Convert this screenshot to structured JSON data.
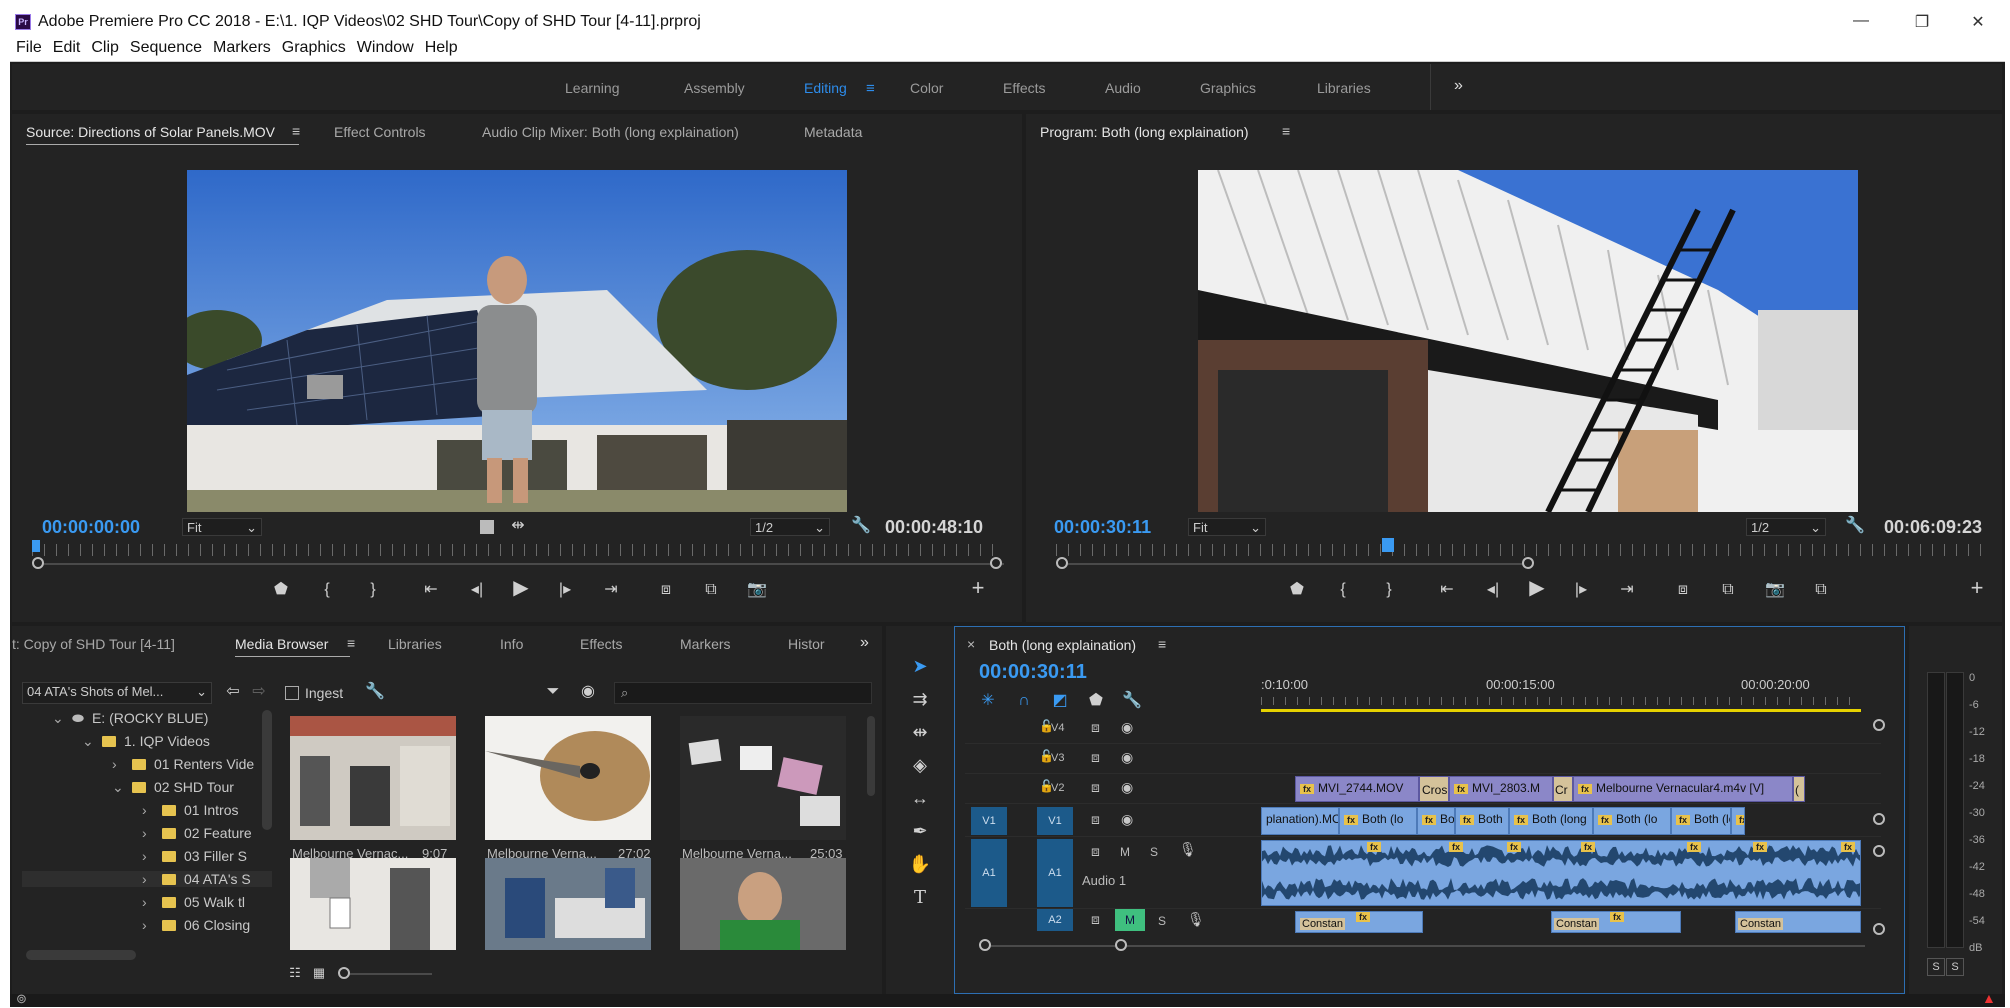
{
  "window": {
    "title": "Adobe Premiere Pro CC 2018 - E:\\1. IQP Videos\\02 SHD Tour\\Copy of SHD Tour [4-11].prproj",
    "app_icon_text": "Pr",
    "controls": {
      "minimize": "—",
      "maximize": "❐",
      "close": "✕"
    }
  },
  "menu": [
    "File",
    "Edit",
    "Clip",
    "Sequence",
    "Markers",
    "Graphics",
    "Window",
    "Help"
  ],
  "workspaces": {
    "items": [
      "Learning",
      "Assembly",
      "Editing",
      "Color",
      "Effects",
      "Audio",
      "Graphics",
      "Libraries"
    ],
    "active": "Editing",
    "overflow": "»"
  },
  "source_monitor": {
    "tabs": [
      "Source: Directions of Solar Panels.MOV",
      "Effect Controls",
      "Audio Clip Mixer: Both (long explaination)",
      "Metadata"
    ],
    "timecode_in": "00:00:00:00",
    "timecode_duration": "00:00:48:10",
    "fit": "Fit",
    "resolution": "1/2",
    "playhead_fraction": 0.0,
    "add_button": "+"
  },
  "program_monitor": {
    "tabs": [
      "Program: Both (long explaination)"
    ],
    "timecode_in": "00:00:30:11",
    "timecode_duration": "00:06:09:23",
    "fit": "Fit",
    "resolution": "1/2",
    "playhead_fraction": 0.35,
    "add_button": "+"
  },
  "project_panel": {
    "tabs": [
      "t: Copy of SHD Tour [4-11]",
      "Media Browser",
      "Libraries",
      "Info",
      "Effects",
      "Markers",
      "Histor"
    ],
    "overflow": "»",
    "location": "04 ATA's Shots of Mel...",
    "ingest_label": "Ingest",
    "search_placeholder": "",
    "tree": [
      {
        "label": "E: (ROCKY BLUE)",
        "indent": 0,
        "kind": "drive",
        "chev": "⌄"
      },
      {
        "label": "1. IQP Videos",
        "indent": 1,
        "kind": "folder",
        "chev": "⌄"
      },
      {
        "label": "01 Renters Vide",
        "indent": 2,
        "kind": "folder",
        "chev": "›"
      },
      {
        "label": "02 SHD Tour",
        "indent": 2,
        "kind": "folder",
        "chev": "⌄"
      },
      {
        "label": "01 Intros",
        "indent": 3,
        "kind": "folder",
        "chev": "›"
      },
      {
        "label": "02 Feature",
        "indent": 3,
        "kind": "folder",
        "chev": "›"
      },
      {
        "label": "03 Filler S",
        "indent": 3,
        "kind": "folder",
        "chev": "›"
      },
      {
        "label": "04 ATA's S",
        "indent": 3,
        "kind": "folder",
        "chev": "›"
      },
      {
        "label": "05 Walk tl",
        "indent": 3,
        "kind": "folder",
        "chev": "›"
      },
      {
        "label": "06 Closing",
        "indent": 3,
        "kind": "folder",
        "chev": "›"
      }
    ],
    "clips": [
      {
        "name": "Melbourne Vernac...",
        "duration": "9:07"
      },
      {
        "name": "Melbourne Verna...",
        "duration": "27:02"
      },
      {
        "name": "Melbourne Verna...",
        "duration": "25:03"
      },
      {
        "name": "",
        "duration": ""
      },
      {
        "name": "",
        "duration": ""
      },
      {
        "name": "",
        "duration": ""
      }
    ]
  },
  "timeline": {
    "sequence_name": "Both (long explaination)",
    "timecode": "00:00:30:11",
    "ruler_labels": [
      ":0:10:00",
      "00:00:15:00",
      "00:00:20:00"
    ],
    "video_tracks": [
      {
        "target": "",
        "name": "V4"
      },
      {
        "target": "",
        "name": "V3"
      },
      {
        "target": "",
        "name": "V2"
      },
      {
        "target": "V1",
        "name": "V1"
      }
    ],
    "audio_tracks": [
      {
        "target": "A1",
        "name": "A1",
        "label": "Audio 1"
      },
      {
        "target": "",
        "name": "A2",
        "label": ""
      }
    ],
    "track_buttons": {
      "mute": "M",
      "solo": "S"
    },
    "v2_clips": [
      {
        "text": "MVI_2744.MOV"
      },
      {
        "text": "Cros"
      },
      {
        "text": "MVI_2803.M"
      },
      {
        "text": "Cr"
      },
      {
        "text": "Melbourne Vernacular4.m4v [V]"
      },
      {
        "text": "("
      }
    ],
    "v1_clips": [
      {
        "text": "planation).MOV [V]"
      },
      {
        "text": "Both (lo"
      },
      {
        "text": "Both"
      },
      {
        "text": "Both"
      },
      {
        "text": "Both (long"
      },
      {
        "text": "Both (lo"
      },
      {
        "text": "Both (lon"
      },
      {
        "text": "B"
      }
    ],
    "a2_clips": [
      {
        "text": "Constan"
      },
      {
        "text": "Constan"
      },
      {
        "text": "Constan"
      }
    ],
    "fx_label": "fx"
  },
  "audio_meter": {
    "scale": [
      "0",
      "-6",
      "-12",
      "-18",
      "-24",
      "-30",
      "-36",
      "-42",
      "-48",
      "-54",
      "dB"
    ],
    "solo_buttons": [
      "S",
      "S"
    ]
  },
  "colors": {
    "accent": "#2d8ceb",
    "timecode": "#3a9af2",
    "video_clip": "#8b87c8",
    "audio_clip": "#7aa6e0",
    "fx_badge": "#e8c24b",
    "target_track": "#1c5a8a"
  }
}
